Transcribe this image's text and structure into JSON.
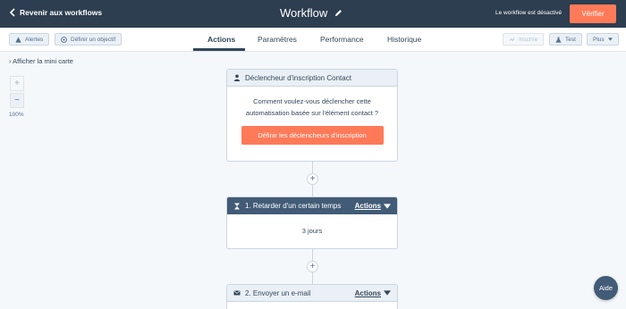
{
  "topbar": {
    "back_label": "Revenir aux workflows",
    "title": "Workflow",
    "status": "Le workflow est désactivé",
    "verify_label": "Vérifier"
  },
  "toolbar": {
    "alerts_label": "Alertes",
    "goal_label": "Définir un objectif",
    "enroll_label": "Inscrire",
    "test_label": "Test",
    "more_label": "Plus"
  },
  "tabs": [
    {
      "label": "Actions",
      "active": true
    },
    {
      "label": "Paramètres",
      "active": false
    },
    {
      "label": "Performance",
      "active": false
    },
    {
      "label": "Historique",
      "active": false
    }
  ],
  "canvas": {
    "minimap_label": "Afficher la mini carte",
    "zoom_in": "+",
    "zoom_out": "−",
    "zoom_level": "100%"
  },
  "trigger": {
    "header": "Déclencheur d'inscription Contact",
    "text": "Comment voulez-vous déclencher cette automatisation basée sur l'élément contact ?",
    "button_label": "Définir les déclencheurs d'inscription"
  },
  "steps": [
    {
      "title": "1. Retarder d'un certain temps",
      "actions_label": "Actions",
      "body": "3 jours"
    },
    {
      "title": "2. Envoyer un e-mail",
      "actions_label": "Actions"
    }
  ],
  "plus_symbol": "+",
  "help_label": "Aide",
  "colors": {
    "topbar": "#2d3e50",
    "accent": "#ff7a59",
    "step_header": "#425b76"
  }
}
